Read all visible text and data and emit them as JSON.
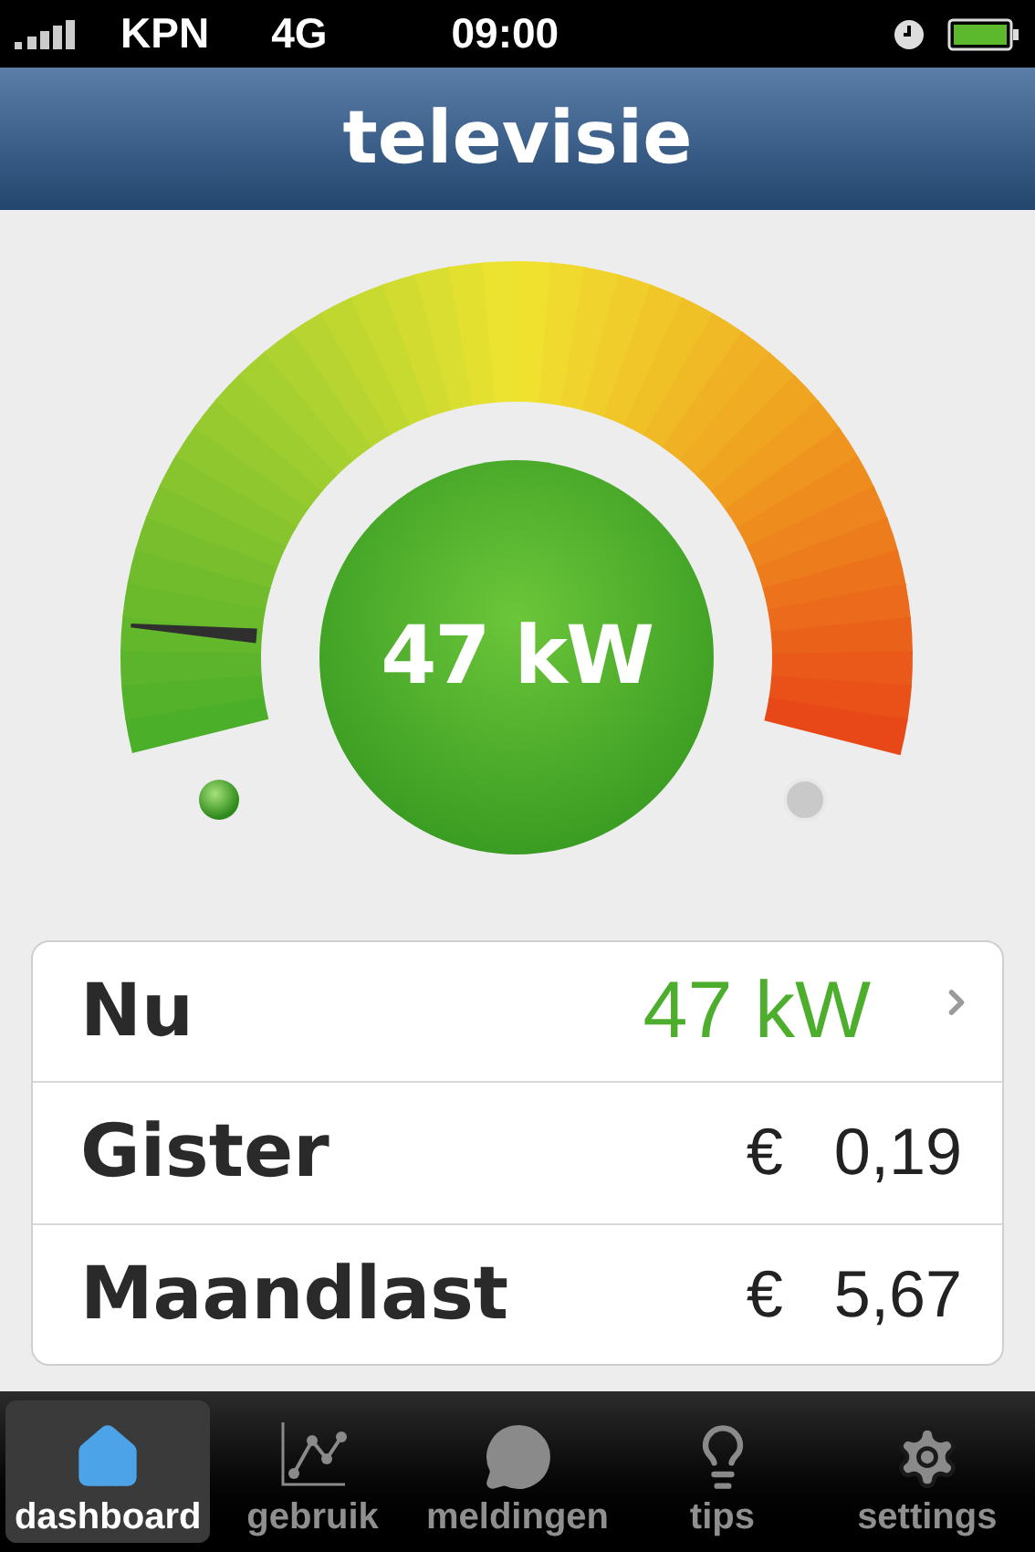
{
  "status_bar": {
    "carrier": "KPN",
    "network": "4G",
    "time": "09:00"
  },
  "header": {
    "title": "televisie"
  },
  "gauge": {
    "reading": "47 kW"
  },
  "summary": [
    {
      "label": "Nu",
      "kind": "power",
      "value": "47 kW"
    },
    {
      "label": "Gister",
      "kind": "cost",
      "currency": "€",
      "value": "0,19"
    },
    {
      "label": "Maandlast",
      "kind": "cost",
      "currency": "€",
      "value": "5,67"
    }
  ],
  "tabs": [
    {
      "label": "dashboard",
      "kind": "home",
      "selected": true
    },
    {
      "label": "gebruik",
      "kind": "chart",
      "selected": false
    },
    {
      "label": "meldingen",
      "kind": "bubble",
      "selected": false
    },
    {
      "label": "tips",
      "kind": "bulb",
      "selected": false
    },
    {
      "label": "settings",
      "kind": "gear",
      "selected": false
    }
  ]
}
